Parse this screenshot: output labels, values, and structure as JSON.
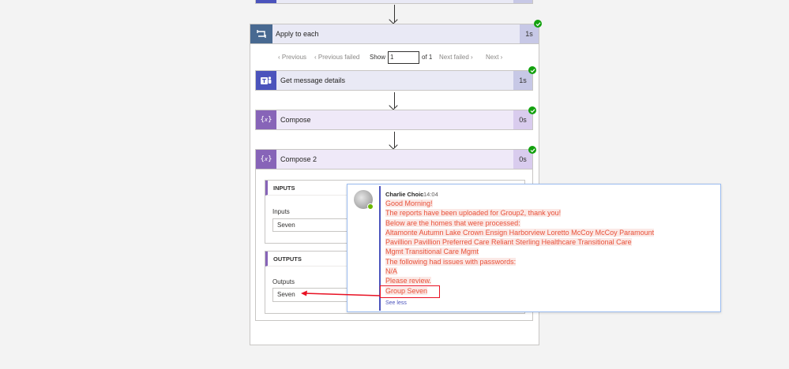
{
  "prev_card": {},
  "apply_each": {
    "title": "Apply to each",
    "duration": "1s",
    "pager": {
      "previous": "Previous",
      "previous_failed": "Previous failed",
      "show": "Show",
      "current": "1",
      "of_total": "of 1",
      "next_failed": "Next failed",
      "next": "Next"
    }
  },
  "actions": {
    "get_message": {
      "title": "Get message details",
      "duration": "1s"
    },
    "compose": {
      "title": "Compose",
      "duration": "0s"
    },
    "compose2": {
      "title": "Compose 2",
      "duration": "0s"
    }
  },
  "compose2_io": {
    "inputs_header": "INPUTS",
    "inputs_label": "Inputs",
    "inputs_value": "Seven",
    "outputs_header": "OUTPUTS",
    "outputs_label": "Outputs",
    "outputs_value": "Seven"
  },
  "teams_message": {
    "author": "Charlie Choic",
    "time": "14:04",
    "lines": [
      "Good Morning!",
      "The reports have been uploaded for Group2, thank you!",
      "Below are the homes that were processed:",
      "Altamonte Autumn Lake Crown Ensign Harborview Loretto McCoy McCoy Paramount",
      "Pavillion Pavillion Preferred Care Reliant Sterling Healthcare Transitional Care",
      "Mgmt Transitional Care Mgmt",
      "The following had issues with passwords:",
      "N/A",
      "Please review.",
      "Group Seven"
    ],
    "see_less": "See less"
  },
  "colors": {
    "teams_purple": "#4b53bc",
    "compose_purple": "#8764b8",
    "success_green": "#13a10e",
    "highlight_red": "#e81123",
    "message_text": "#e8513a"
  },
  "icons": {
    "loop": "loop-icon",
    "teams": "teams-icon",
    "compose": "compose-icon",
    "check": "check-icon"
  }
}
